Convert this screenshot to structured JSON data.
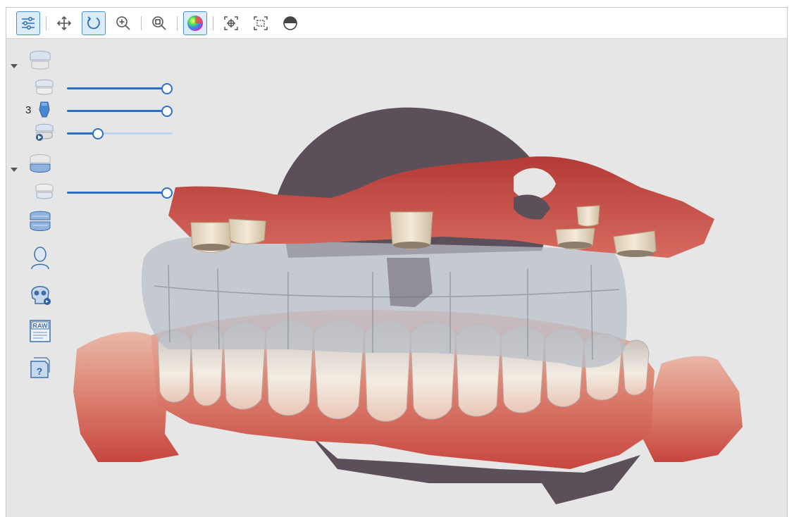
{
  "toolbar": {
    "buttons": [
      {
        "icon": "sliders-icon",
        "active": true
      },
      {
        "icon": "move-icon",
        "active": false
      },
      {
        "icon": "rotate-icon",
        "active": true
      },
      {
        "icon": "zoom-in-icon",
        "active": false
      },
      {
        "icon": "zoom-fit-icon",
        "active": false
      },
      {
        "icon": "color-map-icon",
        "active": true
      },
      {
        "icon": "focus-target-icon",
        "active": false
      },
      {
        "icon": "fit-selection-icon",
        "active": false
      },
      {
        "icon": "half-circle-icon",
        "active": false
      }
    ]
  },
  "panel": {
    "upper_group": {
      "expanded": true,
      "layers": [
        {
          "icon": "upper-jaw-scan-icon",
          "opacity": 1.0
        },
        {
          "icon": "implant-abutment-icon",
          "opacity": 1.0,
          "count": "3"
        },
        {
          "icon": "upper-jaw-prep-icon",
          "opacity": 0.3
        }
      ]
    },
    "lower_group": {
      "expanded": true,
      "layers": [
        {
          "icon": "lower-jaw-scan-icon",
          "opacity": 1.0
        }
      ]
    },
    "extra_icons": [
      "bite-scan-icon",
      "face-scan-icon",
      "cbct-skull-icon",
      "raw-file-icon",
      "unknown-file-icon"
    ],
    "raw_label": "RAW",
    "unknown_label": "?"
  },
  "colors": {
    "accent": "#2e6fc0",
    "viewport_bg": "#e6e6e6",
    "gingiva": "#c9514a",
    "tooth": "#ece4d8",
    "tissue_dark": "#5a4d58",
    "transparent_prosthesis": "#b9bec8"
  }
}
